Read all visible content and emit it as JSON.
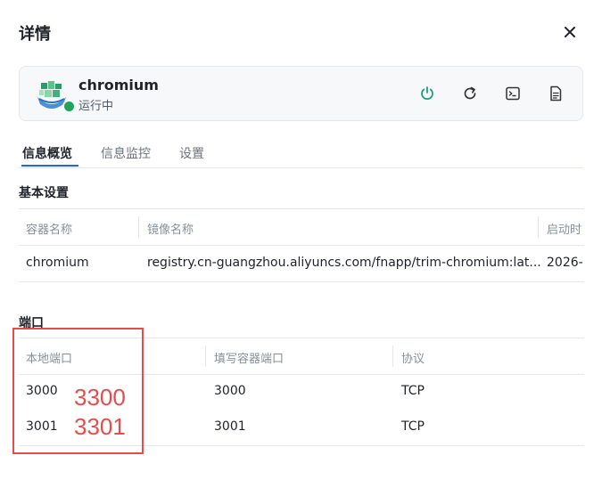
{
  "dialog": {
    "title": "详情"
  },
  "app": {
    "name": "chromium",
    "status": "运行中"
  },
  "actions": [
    "power-icon",
    "restart-icon",
    "terminal-icon",
    "log-icon"
  ],
  "colors": {
    "running": "#22a35a",
    "power": "#1e9e7a",
    "accent": "#2563eb",
    "annotation": "#e84c4c"
  },
  "tabs": [
    {
      "label": "信息概览",
      "active": true
    },
    {
      "label": "信息监控",
      "active": false
    },
    {
      "label": "设置",
      "active": false
    }
  ],
  "basic": {
    "title": "基本设置",
    "headers": [
      "容器名称",
      "镜像名称",
      "启动时"
    ],
    "row": [
      "chromium",
      "registry.cn-guangzhou.aliyuncs.com/fnapp/trim-chromium:lat...",
      "2026-"
    ]
  },
  "ports": {
    "title": "端口",
    "headers": [
      "本地端口",
      "填写容器端口",
      "协议"
    ],
    "rows": [
      {
        "local": "3000",
        "container": "3000",
        "protocol": "TCP"
      },
      {
        "local": "3001",
        "container": "3001",
        "protocol": "TCP"
      }
    ]
  },
  "annotation": {
    "values": [
      "3300",
      "3301"
    ]
  }
}
